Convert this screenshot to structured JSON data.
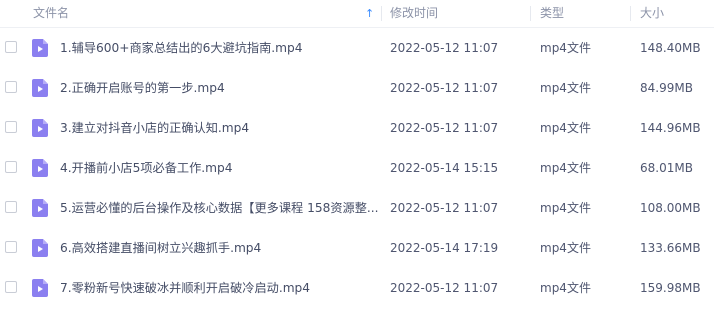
{
  "header": {
    "name": "文件名",
    "modified": "修改时间",
    "type": "类型",
    "size": "大小"
  },
  "files": [
    {
      "name": "1.辅导600+商家总结出的6大避坑指南.mp4",
      "modified": "2022-05-12 11:07",
      "type": "mp4文件",
      "size": "148.40MB"
    },
    {
      "name": "2.正确开启账号的第一步.mp4",
      "modified": "2022-05-12 11:07",
      "type": "mp4文件",
      "size": "84.99MB"
    },
    {
      "name": "3.建立对抖音小店的正确认知.mp4",
      "modified": "2022-05-12 11:07",
      "type": "mp4文件",
      "size": "144.96MB"
    },
    {
      "name": "4.开播前小店5项必备工作.mp4",
      "modified": "2022-05-14 15:15",
      "type": "mp4文件",
      "size": "68.01MB"
    },
    {
      "name": "5.运营必懂的后台操作及核心数据【更多课程 158资源整...",
      "modified": "2022-05-12 11:07",
      "type": "mp4文件",
      "size": "108.00MB"
    },
    {
      "name": "6.高效搭建直播间树立兴趣抓手.mp4",
      "modified": "2022-05-14 17:19",
      "type": "mp4文件",
      "size": "133.66MB"
    },
    {
      "name": "7.零粉新号快速破冰并顺利开启破冷启动.mp4",
      "modified": "2022-05-12 11:07",
      "type": "mp4文件",
      "size": "159.98MB"
    }
  ],
  "colors": {
    "video_icon": "#8b7ff0",
    "sort_arrow": "#3b8cff"
  },
  "icons": {
    "sort": "arrow-up-icon",
    "file": "video-file-icon"
  }
}
